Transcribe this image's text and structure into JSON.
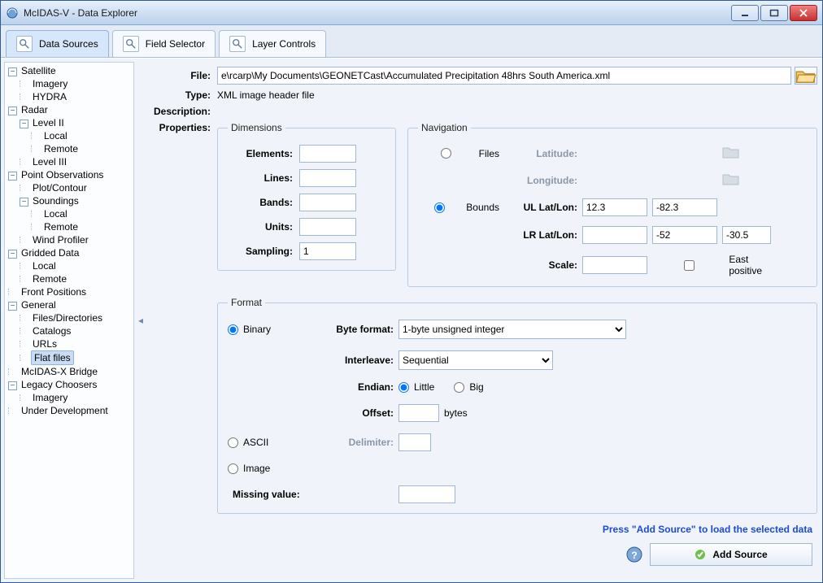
{
  "window": {
    "title": "McIDAS-V - Data Explorer"
  },
  "tabs": [
    {
      "label": "Data Sources",
      "active": true
    },
    {
      "label": "Field Selector",
      "active": false
    },
    {
      "label": "Layer Controls",
      "active": false
    }
  ],
  "tree": {
    "Satellite": [
      "Imagery",
      "HYDRA"
    ],
    "Radar": {
      "Level II": [
        "Local",
        "Remote"
      ],
      "_after": [
        "Level III"
      ]
    },
    "Point Observations": {
      "_before": [
        "Plot/Contour"
      ],
      "Soundings": [
        "Local",
        "Remote"
      ],
      "_after": [
        "Wind Profiler"
      ]
    },
    "Gridded Data": [
      "Local",
      "Remote"
    ],
    "Front Positions": null,
    "General": [
      "Files/Directories",
      "Catalogs",
      "URLs",
      "Flat files"
    ],
    "McIDAS-X Bridge": null,
    "Legacy Choosers": [
      "Imagery"
    ],
    "Under Development": null,
    "selected": "Flat files"
  },
  "file": {
    "label": "File:",
    "value": "e\\rcarp\\My Documents\\GEONETCast\\Accumulated Precipitation 48hrs South America.xml"
  },
  "type": {
    "label": "Type:",
    "value": "XML image header file"
  },
  "description": {
    "label": "Description:",
    "value": ""
  },
  "properties_label": "Properties:",
  "dimensions": {
    "legend": "Dimensions",
    "elements": {
      "label": "Elements:",
      "value": ""
    },
    "lines": {
      "label": "Lines:",
      "value": ""
    },
    "bands": {
      "label": "Bands:",
      "value": ""
    },
    "units": {
      "label": "Units:",
      "value": ""
    },
    "sampling": {
      "label": "Sampling:",
      "value": "1"
    }
  },
  "navigation": {
    "legend": "Navigation",
    "files_label": "Files",
    "bounds_label": "Bounds",
    "mode": "bounds",
    "latitude_label": "Latitude:",
    "longitude_label": "Longitude:",
    "ul_label": "UL Lat/Lon:",
    "lr_label": "LR Lat/Lon:",
    "ul_lat": "12.3",
    "ul_lon": "-82.3",
    "lr_lat": "-52",
    "lr_lon": "-30.5",
    "lr_extra": "",
    "scale_label": "Scale:",
    "scale": "",
    "east_positive_label": "East positive",
    "east_positive": false
  },
  "format": {
    "legend": "Format",
    "binary_label": "Binary",
    "ascii_label": "ASCII",
    "image_label": "Image",
    "mode": "binary",
    "byte_format_label": "Byte format:",
    "byte_format": "1-byte unsigned integer",
    "interleave_label": "Interleave:",
    "interleave": "Sequential",
    "endian_label": "Endian:",
    "endian_little": "Little",
    "endian_big": "Big",
    "endian": "little",
    "offset_label": "Offset:",
    "offset": "",
    "offset_unit": "bytes",
    "delimiter_label": "Delimiter:",
    "delimiter": "",
    "missing_label": "Missing value:",
    "missing": ""
  },
  "hint": "Press \"Add Source\" to load the selected data",
  "add_button": "Add Source"
}
